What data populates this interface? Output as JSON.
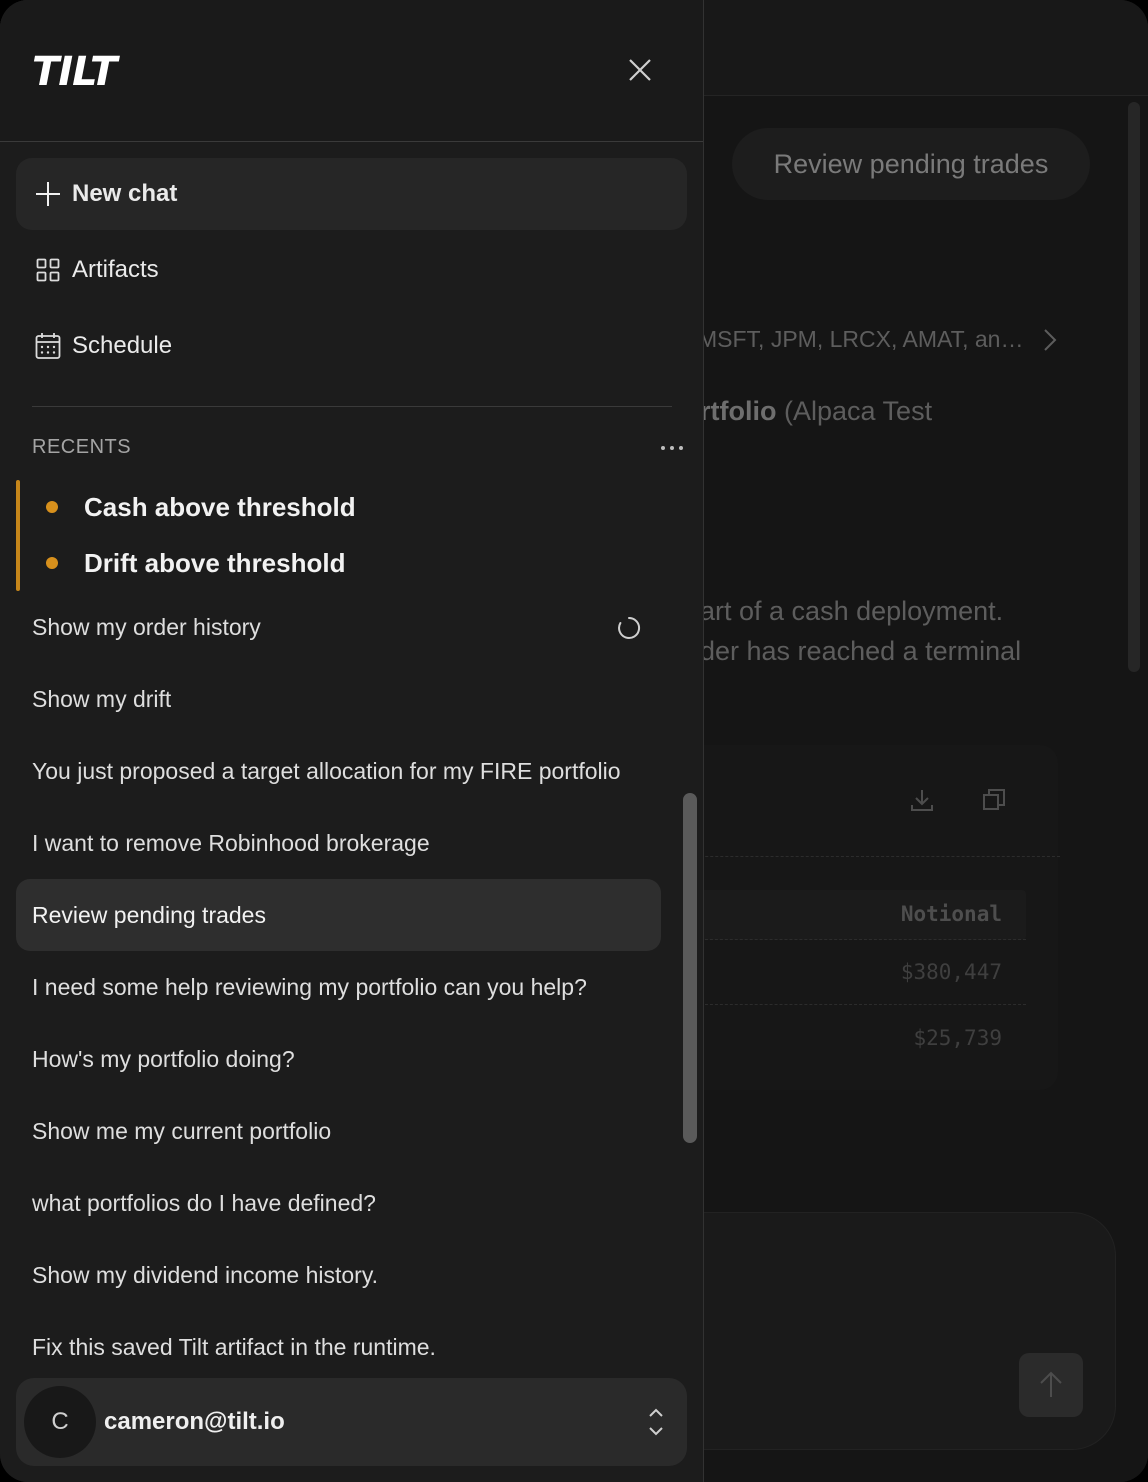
{
  "background": {
    "pill_label": "Review pending trades",
    "tickers_text": "MSFT, JPM, LRCX, AMAT, an…",
    "portfolio_bold": "rtfolio",
    "portfolio_rest": " (Alpaca Test",
    "body_line_1": "art of a cash deployment.",
    "body_line_2": "der has reached a terminal",
    "table": {
      "column_header": "Notional",
      "rows": [
        "$380,447",
        "$25,739"
      ]
    }
  },
  "sidebar": {
    "logo_text": "TILT",
    "nav": {
      "new_chat": "New chat",
      "artifacts": "Artifacts",
      "schedule": "Schedule"
    },
    "recents_label": "RECENTS",
    "alerts": [
      "Cash above threshold",
      "Drift above threshold"
    ],
    "recents": [
      "Show my order history",
      "Show my drift",
      "You just proposed a target allocation for my FIRE portfolio",
      "I want to remove Robinhood brokerage",
      "Review pending trades",
      "I need some help reviewing my portfolio can you help?",
      "How's my portfolio doing?",
      "Show me my current portfolio",
      "what portfolios do I have defined?",
      "Show my dividend income history.",
      "Fix this saved Tilt artifact in the runtime."
    ],
    "active_recent": "Review pending trades",
    "user": {
      "initial": "C",
      "email": "cameron@tilt.io"
    }
  },
  "colors": {
    "accent_alert": "#d7901c",
    "sidebar_bg": "#1c1c1c",
    "active_item_bg": "#2e2e2e"
  },
  "icons": [
    "close-icon",
    "plus-icon",
    "grid-icon",
    "calendar-icon",
    "more-icon",
    "spinner-icon",
    "chevron-right-icon",
    "download-icon",
    "copy-icon",
    "arrow-up-icon",
    "chevron-updown-icon"
  ]
}
